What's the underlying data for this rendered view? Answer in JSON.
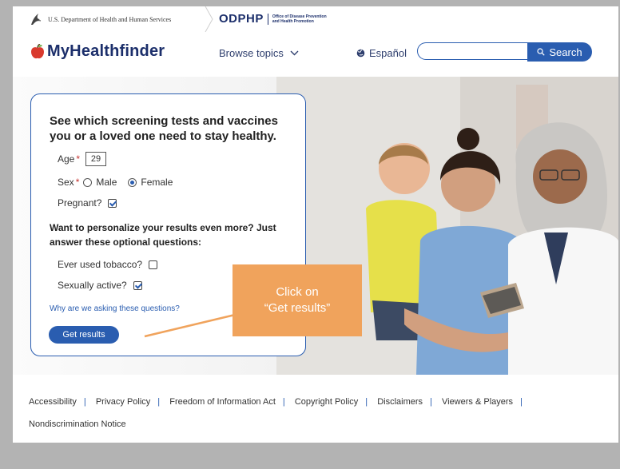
{
  "gov": {
    "hhs_text": "U.S. Department of Health and Human Services",
    "odphp_mark": "ODPHP",
    "odphp_sub": "Office of Disease Prevention and Health Promotion"
  },
  "header": {
    "brand": "MyHealthfinder",
    "browse_label": "Browse topics",
    "espanol_label": "Español",
    "search_placeholder": "",
    "search_button": "Search"
  },
  "form": {
    "title": "See which screening tests and vaccines you or a loved one need to stay healthy.",
    "age_label": "Age",
    "age_value": "29",
    "sex_label": "Sex",
    "sex_options": [
      "Male",
      "Female"
    ],
    "sex_selected": "Female",
    "pregnant_label": "Pregnant?",
    "pregnant_checked": true,
    "personalize_text": "Want to personalize your results even more? Just answer these optional questions:",
    "tobacco_label": "Ever used tobacco?",
    "tobacco_checked": false,
    "sexually_active_label": "Sexually active?",
    "sexually_active_checked": true,
    "why_link": "Why are we asking these questions?",
    "get_results": "Get results",
    "required_mark": "*"
  },
  "callout": {
    "line1": "Click on",
    "line2": "“Get results”"
  },
  "footer": {
    "links": [
      "Accessibility",
      "Privacy Policy",
      "Freedom of Information Act",
      "Copyright Policy",
      "Disclaimers",
      "Viewers & Players",
      "Nondiscrimination Notice"
    ]
  },
  "colors": {
    "brand_blue": "#2a5db0",
    "navy": "#1c2f6b",
    "callout_orange": "#f0a35c",
    "apple_red": "#d93a2e"
  }
}
